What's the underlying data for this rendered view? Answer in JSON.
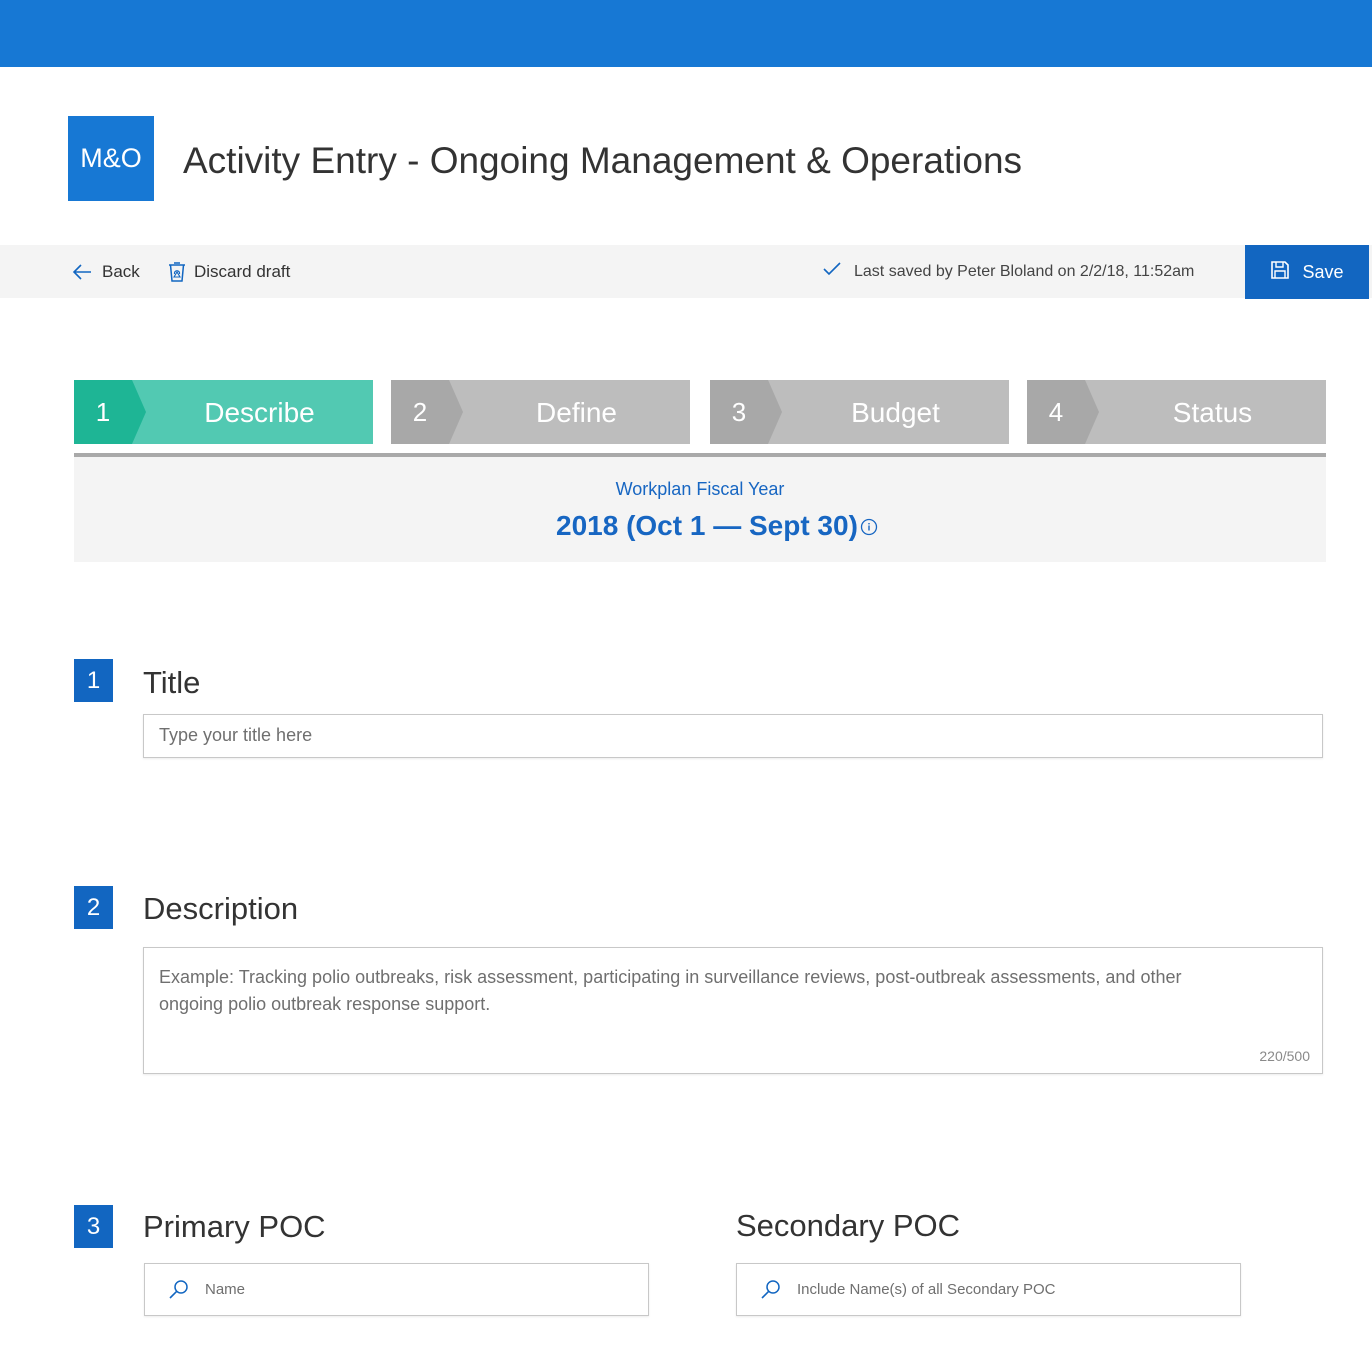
{
  "header": {
    "logo_text": "M&O",
    "title": "Activity Entry - Ongoing Management & Operations",
    "accent_color": "#1778d4"
  },
  "toolbar": {
    "back_label": "Back",
    "discard_label": "Discard draft",
    "last_saved": "Last saved by Peter Bloland on 2/2/18, 11:52am",
    "save_label": "Save",
    "icons": {
      "back": "arrow-left-icon",
      "discard": "recycle-bin-icon",
      "saved": "checkmark-icon",
      "save": "floppy-disk-icon"
    }
  },
  "steps": [
    {
      "number": "1",
      "label": "Describe",
      "active": true
    },
    {
      "number": "2",
      "label": "Define",
      "active": false
    },
    {
      "number": "3",
      "label": "Budget",
      "active": false
    },
    {
      "number": "4",
      "label": "Status",
      "active": false
    }
  ],
  "fiscal_year": {
    "label": "Workplan Fiscal Year",
    "value": "2018 (Oct 1 — Sept 30)",
    "info_icon": "info-icon"
  },
  "sections": {
    "title": {
      "number": "1",
      "heading": "Title",
      "placeholder": "Type your title here"
    },
    "description": {
      "number": "2",
      "heading": "Description",
      "placeholder": "Example: Tracking polio outbreaks, risk assessment, participating in surveillance reviews, post-outbreak assessments, and other ongoing polio outbreak response support.",
      "counter": "220/500"
    },
    "poc": {
      "number": "3",
      "primary_heading": "Primary POC",
      "primary_placeholder": "Name",
      "secondary_heading": "Secondary POC",
      "secondary_placeholder": "Include Name(s) of all Secondary POC",
      "icon": "search-icon"
    }
  },
  "colors": {
    "step_active": "#52c9b2",
    "step_active_number": "#1eb595",
    "step_inactive": "#bdbdbd",
    "primary_blue": "#1266c1"
  }
}
